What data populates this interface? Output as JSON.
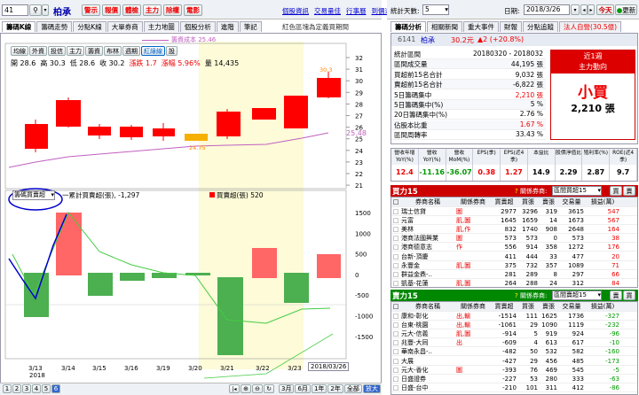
{
  "toolbar": {
    "code": "41",
    "name": "柏承",
    "buttons": [
      "警示",
      "報價",
      "體檢",
      "主力",
      "除權",
      "電影"
    ],
    "buttons_color": "#e00",
    "links": [
      "個股資訊",
      "交易量佳",
      "行事曆",
      "到價通知"
    ]
  },
  "tabs_left": [
    "籌碼K線",
    "籌碼走勢",
    "分點K線",
    "大單券商",
    "主力地圖",
    "個股分析",
    "進階",
    "筆記"
  ],
  "legend_note": "紅色區塊為定義買期間",
  "selectors": [
    "均線",
    "外資",
    "投信",
    "主力",
    "籌資",
    "布林",
    "週期",
    "紅綠線",
    "設"
  ],
  "ohlc": {
    "open_label": "開",
    "open": "28.6",
    "high_label": "高",
    "high": "30.3",
    "low_label": "低",
    "low": "28.6",
    "close_label": "收",
    "close": "30.2",
    "change_label": "漲跌",
    "change": "1.7",
    "pct_label": "漲幅",
    "pct": "5.96%",
    "vol_label": "量",
    "vol": "14,435"
  },
  "ma_label": "籌資成本 25.46",
  "price_axis": [
    "32",
    "31",
    "30",
    "29",
    "28",
    "27",
    "26",
    "25",
    "24",
    "23",
    "22",
    "21"
  ],
  "price_tag": "25.48",
  "bars_high": "30.3",
  "bars_low": "24.75",
  "lower": {
    "select": "籌碼買賣超",
    "line_label": "一累計買賣超(張)",
    "line_value": "-1,297",
    "bar_label": "買賣超(張)",
    "bar_value": "520"
  },
  "vol_axis": [
    "1500",
    "1000",
    "500",
    "0",
    "-500",
    "-1000",
    "-1500"
  ],
  "dates": [
    "3/13",
    "3/14",
    "3/15",
    "3/16",
    "3/19",
    "3/20",
    "3/21",
    "3/22",
    "3/23",
    "2018/03/26"
  ],
  "year": "2018",
  "pager": [
    "1",
    "2",
    "3",
    "4",
    "5",
    "6"
  ],
  "zoom": [
    "3月",
    "6月",
    "1年",
    "2年",
    "全部",
    "放大"
  ],
  "right_top": {
    "days_label": "統計天數:",
    "days": "5",
    "date_label": "日期:",
    "date": "2018/3/26",
    "today": "今天",
    "refresh": "更新"
  },
  "tabs_right": [
    "籌碼分析",
    "相關新聞",
    "重大事件",
    "財報",
    "分點追蹤",
    "法人自營(30.5億)"
  ],
  "quote": {
    "code": "6141",
    "name": "柏承",
    "price": "30.2元",
    "chg": "▲2 (+20.8%)"
  },
  "stats": [
    [
      "統計區間",
      "20180320 - 2018032"
    ],
    [
      "區間成交量",
      "44,195 張"
    ],
    [
      "買超前15名合計",
      "9,032 張"
    ],
    [
      "賣超前15名合計",
      "-6,822 張"
    ],
    [
      "5日籌碼集中",
      "2,210 張"
    ],
    [
      "5日籌碼集中(%)",
      "5 %"
    ],
    [
      "20日籌碼集中(%)",
      "2.76 %"
    ],
    [
      "佔股本比重",
      "1.67 %"
    ],
    [
      "區間周轉率",
      "33.43 %"
    ]
  ],
  "main_buy": {
    "title": "近1週",
    "sub": "主力動向",
    "big": "小買",
    "amount": "2,210 張"
  },
  "fund": {
    "headers": [
      "營收年增YoY(%)",
      "營收YoY(%)",
      "營收MoM(%)",
      "EPS(季)",
      "EPS(近4季)",
      "本益比",
      "股價淨值比",
      "殖利率(%)",
      "ROE(近4季)"
    ],
    "values": [
      "12.4",
      "-11.16",
      "-36.07",
      "0.38",
      "1.27",
      "14.9",
      "2.29",
      "2.87",
      "9.7"
    ]
  },
  "buy_panel": {
    "title": "買力15",
    "related": "關係券商",
    "select": "區間買超15",
    "btn1": "買",
    "btn2": "賣",
    "cols": [
      "券商名稱",
      "關係券商",
      "買賣超",
      "買張",
      "賣張",
      "交易量",
      "損益(萬)"
    ],
    "rows": [
      [
        "瑞士信貸",
        "圖",
        "2977",
        "3296",
        "319",
        "3615",
        "547"
      ],
      [
        "元富",
        "肌,圖",
        "1645",
        "1659",
        "14",
        "1673",
        "567"
      ],
      [
        "美林",
        "肌,作",
        "832",
        "1740",
        "908",
        "2648",
        "164"
      ],
      [
        "港商法國興業",
        "圖",
        "573",
        "573",
        "0",
        "573",
        "38"
      ],
      [
        "港商德意志",
        "作",
        "556",
        "914",
        "358",
        "1272",
        "176"
      ],
      [
        "台新-頂慶",
        "",
        "411",
        "444",
        "33",
        "477",
        "20"
      ],
      [
        "永豐金",
        "肌,圖",
        "375",
        "732",
        "357",
        "1089",
        "71"
      ],
      [
        "群益金鼎-..",
        "",
        "281",
        "289",
        "8",
        "297",
        "66"
      ],
      [
        "凱基-花蓮",
        "肌,圖",
        "264",
        "288",
        "24",
        "312",
        "84"
      ]
    ]
  },
  "sell_panel": {
    "title": "賣力15",
    "related": "關係券商",
    "select": "區間賣超15",
    "btn1": "賣",
    "btn2": "買",
    "cols": [
      "券商名稱",
      "關係券商",
      "買賣超",
      "買張",
      "賣張",
      "交易量",
      "損益(萬)"
    ],
    "rows": [
      [
        "康和-彰化",
        "出,輸",
        "-1514",
        "111",
        "1625",
        "1736",
        "-327"
      ],
      [
        "台東-桃園",
        "出,輸",
        "-1061",
        "29",
        "1090",
        "1119",
        "-232"
      ],
      [
        "元大-信義",
        "肌,圖",
        "-914",
        "5",
        "919",
        "924",
        "-96"
      ],
      [
        "兆豐-大同",
        "出",
        "-609",
        "4",
        "613",
        "617",
        "-10"
      ],
      [
        "華南永昌-..",
        "",
        "-482",
        "50",
        "532",
        "582",
        "-160"
      ],
      [
        "大展",
        "",
        "-427",
        "29",
        "456",
        "485",
        "-173"
      ],
      [
        "元大-香化",
        "圖",
        "-393",
        "76",
        "469",
        "545",
        "-5"
      ],
      [
        "日盛證券",
        "",
        "-227",
        "53",
        "280",
        "333",
        "-63"
      ],
      [
        "日盛-台中",
        "",
        "-210",
        "101",
        "311",
        "412",
        "-86"
      ]
    ]
  }
}
